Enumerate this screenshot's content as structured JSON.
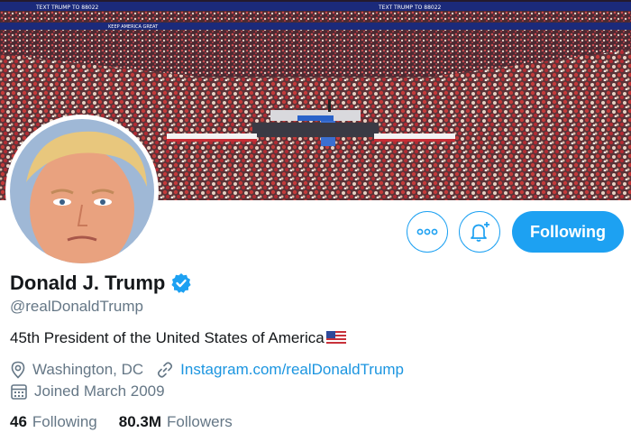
{
  "banner": {
    "signage_text": "TEXT TRUMP TO 88022",
    "signage_text_2": "KEEP AMERICA GREAT"
  },
  "profile": {
    "display_name": "Donald J. Trump",
    "handle": "@realDonaldTrump",
    "verified": true,
    "bio": "45th President of the United States of America",
    "bio_emoji": "us-flag",
    "location": "Washington, DC",
    "website": "Instagram.com/realDonaldTrump",
    "joined": "Joined March 2009"
  },
  "actions": {
    "more_icon": "more-icon",
    "notify_icon": "bell-plus-icon",
    "following_label": "Following"
  },
  "stats": {
    "following_count": "46",
    "following_label": "Following",
    "followers_count": "80.3M",
    "followers_label": "Followers"
  },
  "colors": {
    "accent": "#1da1f2",
    "link": "#1b95e0",
    "secondary_text": "#657786",
    "primary_text": "#14171a"
  }
}
